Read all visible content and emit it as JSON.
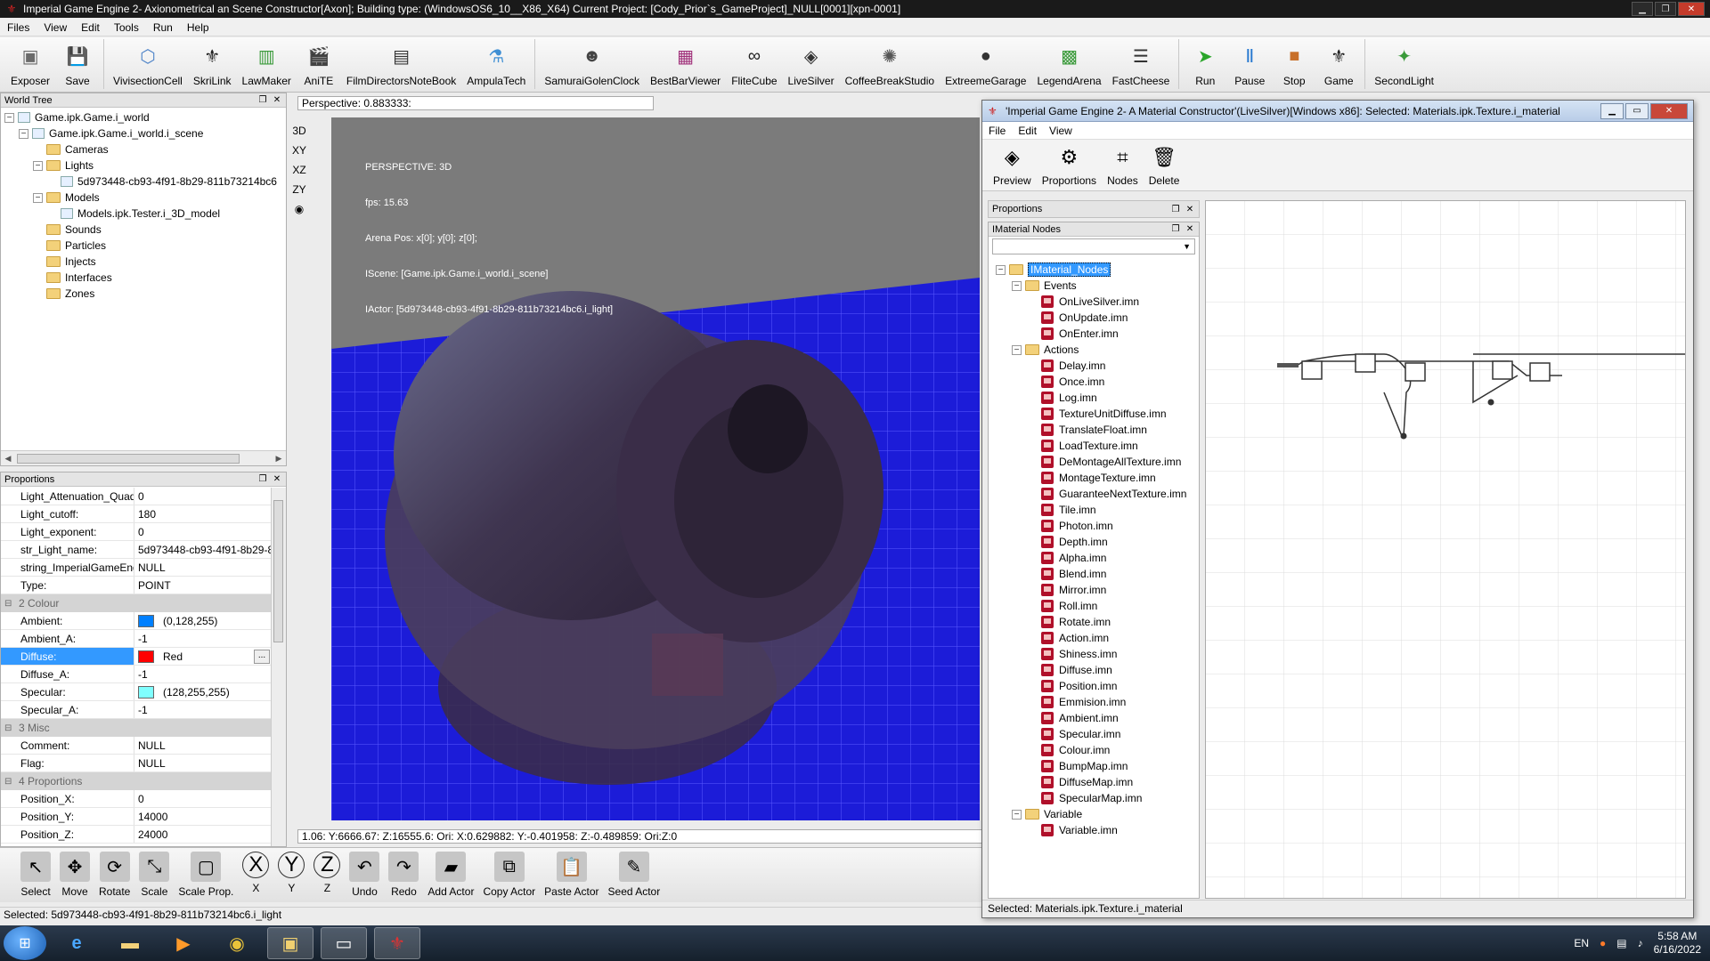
{
  "main_window": {
    "title": "Imperial Game Engine 2- Axionometrical an Scene Constructor[Axon]; Building type: (WindowsOS6_10__X86_X64) Current Project: [Cody_Prior`s_GameProject]_NULL[0001][xpn-0001]"
  },
  "menu": [
    "Files",
    "View",
    "Edit",
    "Tools",
    "Run",
    "Help"
  ],
  "toolbar": [
    {
      "label": "Exposer",
      "icon": "exposer-icon",
      "color": "#6a6a6a"
    },
    {
      "label": "Save",
      "icon": "floppy-icon",
      "color": "#333333"
    },
    {
      "label": "VivisectionCell",
      "icon": "cube-icon",
      "color": "#4f84c8"
    },
    {
      "label": "SkriLink",
      "icon": "eagle-icon",
      "color": "#222222"
    },
    {
      "label": "LawMaker",
      "icon": "chart-icon",
      "color": "#3a9a3a"
    },
    {
      "label": "AniTE",
      "icon": "clapper-icon",
      "color": "#222222"
    },
    {
      "label": "FilmDirectorsNoteBook",
      "icon": "notebook-icon",
      "color": "#333333"
    },
    {
      "label": "AmpulaTech",
      "icon": "ampule-icon",
      "color": "#3f8fd4"
    },
    {
      "label": "SamuraiGolenClock",
      "icon": "mask-icon",
      "color": "#444444"
    },
    {
      "label": "BestBarViewer",
      "icon": "bar-icon",
      "color": "#a0307a"
    },
    {
      "label": "FliteCube",
      "icon": "loop-icon",
      "color": "#222222"
    },
    {
      "label": "LiveSilver",
      "icon": "diamond-icon",
      "color": "#333333"
    },
    {
      "label": "CoffeeBreakStudio",
      "icon": "atom-icon",
      "color": "#555555"
    },
    {
      "label": "ExtreemeGarage",
      "icon": "balls-icon",
      "color": "#333333"
    },
    {
      "label": "LegendArena",
      "icon": "arena-icon",
      "color": "#3a9a3a"
    },
    {
      "label": "FastCheese",
      "icon": "sliders-icon",
      "color": "#333333"
    },
    {
      "label": "Run",
      "icon": "run-icon",
      "color": "#2aa52a"
    },
    {
      "label": "Pause",
      "icon": "pause-icon",
      "color": "#2a7ad0"
    },
    {
      "label": "Stop",
      "icon": "stop-icon",
      "color": "#c8702a"
    },
    {
      "label": "Game",
      "icon": "game-icon",
      "color": "#222222"
    },
    {
      "label": "SecondLight",
      "icon": "secondlight-icon",
      "color": "#3a9a3a"
    }
  ],
  "world_tree": {
    "title": "World Tree",
    "items": [
      {
        "label": "Game.ipk.Game.i_world",
        "level": 0,
        "kind": "node",
        "toggle": "−"
      },
      {
        "label": "Game.ipk.Game.i_world.i_scene",
        "level": 1,
        "kind": "node",
        "toggle": "−"
      },
      {
        "label": "Cameras",
        "level": 2,
        "kind": "folder",
        "toggle": ""
      },
      {
        "label": "Lights",
        "level": 2,
        "kind": "folder",
        "toggle": "−"
      },
      {
        "label": "5d973448-cb93-4f91-8b29-811b73214bc6",
        "level": 3,
        "kind": "node",
        "toggle": ""
      },
      {
        "label": "Models",
        "level": 2,
        "kind": "folder",
        "toggle": "−"
      },
      {
        "label": "Models.ipk.Tester.i_3D_model",
        "level": 3,
        "kind": "node",
        "toggle": ""
      },
      {
        "label": "Sounds",
        "level": 2,
        "kind": "folder",
        "toggle": ""
      },
      {
        "label": "Particles",
        "level": 2,
        "kind": "folder",
        "toggle": ""
      },
      {
        "label": "Injects",
        "level": 2,
        "kind": "folder",
        "toggle": ""
      },
      {
        "label": "Interfaces",
        "level": 2,
        "kind": "folder",
        "toggle": ""
      },
      {
        "label": "Zones",
        "level": 2,
        "kind": "folder",
        "toggle": ""
      }
    ]
  },
  "proportions": {
    "title": "Proportions",
    "rows": [
      {
        "type": "prop",
        "key": "Light_Attenuation_Quad",
        "value": "0"
      },
      {
        "type": "prop",
        "key": "Light_cutoff:",
        "value": "180"
      },
      {
        "type": "prop",
        "key": "Light_exponent:",
        "value": "0"
      },
      {
        "type": "prop",
        "key": "str_Light_name:",
        "value": "5d973448-cb93-4f91-8b29-811b73214bc6"
      },
      {
        "type": "prop",
        "key": "string_ImperialGameEngine",
        "value": "NULL"
      },
      {
        "type": "prop",
        "key": "Type:",
        "value": "POINT"
      },
      {
        "type": "cat",
        "key": "2 Colour"
      },
      {
        "type": "prop",
        "key": "Ambient:",
        "value": "(0,128,255)",
        "swatch": "#0080ff"
      },
      {
        "type": "prop",
        "key": "Ambient_A:",
        "value": "-1"
      },
      {
        "type": "prop",
        "key": "Diffuse:",
        "value": "Red",
        "swatch": "#ff0000",
        "selected": true,
        "button": "..."
      },
      {
        "type": "prop",
        "key": "Diffuse_A:",
        "value": "-1"
      },
      {
        "type": "prop",
        "key": "Specular:",
        "value": "(128,255,255)",
        "swatch": "#80ffff"
      },
      {
        "type": "prop",
        "key": "Specular_A:",
        "value": "-1"
      },
      {
        "type": "cat",
        "key": "3 Misc"
      },
      {
        "type": "prop",
        "key": "Comment:",
        "value": "NULL"
      },
      {
        "type": "prop",
        "key": "Flag:",
        "value": "NULL"
      },
      {
        "type": "cat",
        "key": "4 Proportions"
      },
      {
        "type": "prop",
        "key": "Position_X:",
        "value": "0"
      },
      {
        "type": "prop",
        "key": "Position_Y:",
        "value": "14000"
      },
      {
        "type": "prop",
        "key": "Position_Z:",
        "value": "24000"
      }
    ]
  },
  "view_tools": [
    "3D",
    "XY",
    "XZ",
    "ZY"
  ],
  "viewport": {
    "perspective": "Perspective: 0.883333:",
    "hud": [
      "PERSPECTIVE: 3D",
      "fps: 15.63",
      "Arena Pos: x[0]; y[0]; z[0];",
      "IScene: [Game.ipk.Game.i_world.i_scene]",
      "IActor: [5d973448-cb93-4f91-8b29-811b73214bc6.i_light]"
    ],
    "coords": "1.06: Y:6666.67: Z:16555.6: Ori: X:0.629882: Y:-0.401958: Z:-0.489859: Ori:Z:0"
  },
  "bottom_toolbar": [
    {
      "label": "Select",
      "icon": "select-icon"
    },
    {
      "label": "Move",
      "icon": "move-icon"
    },
    {
      "label": "Rotate",
      "icon": "rotate-icon"
    },
    {
      "label": "Scale",
      "icon": "scale-icon"
    },
    {
      "label": "Scale Prop.",
      "icon": "scale-prop-icon"
    },
    {
      "label": "X",
      "icon": "x-axis-icon",
      "glyph": "X"
    },
    {
      "label": "Y",
      "icon": "y-axis-icon",
      "glyph": "Y"
    },
    {
      "label": "Z",
      "icon": "z-axis-icon",
      "glyph": "Z"
    },
    {
      "label": "Undo",
      "icon": "undo-icon"
    },
    {
      "label": "Redo",
      "icon": "redo-icon"
    },
    {
      "label": "Add Actor",
      "icon": "add-actor-icon"
    },
    {
      "label": "Copy Actor",
      "icon": "copy-actor-icon"
    },
    {
      "label": "Paste Actor",
      "icon": "paste-actor-icon"
    },
    {
      "label": "Seed Actor",
      "icon": "seed-actor-icon"
    }
  ],
  "status": "Selected: 5d973448-cb93-4f91-8b29-811b73214bc6.i_light",
  "material_window": {
    "title": "'Imperial Game Engine 2- A Material Constructor'(LiveSilver)[Windows x86]:   Selected:    Materials.ipk.Texture.i_material",
    "menu": [
      "File",
      "Edit",
      "View"
    ],
    "toolbar": [
      {
        "label": "Preview",
        "icon": "preview-diamond-icon"
      },
      {
        "label": "Proportions",
        "icon": "proportions-gear-icon"
      },
      {
        "label": "Nodes",
        "icon": "nodes-icon"
      },
      {
        "label": "Delete",
        "icon": "trash-icon"
      }
    ],
    "proportions_title": "Proportions",
    "nodes_title": "IMaterial Nodes",
    "tree_root": "IMaterial_Nodes",
    "events_label": "Events",
    "events": [
      "OnLiveSilver.imn",
      "OnUpdate.imn",
      "OnEnter.imn"
    ],
    "actions_label": "Actions",
    "actions": [
      "Delay.imn",
      "Once.imn",
      "Log.imn",
      "TextureUnitDiffuse.imn",
      "TranslateFloat.imn",
      "LoadTexture.imn",
      "DeMontageAllTexture.imn",
      "MontageTexture.imn",
      "GuaranteeNextTexture.imn",
      "Tile.imn",
      "Photon.imn",
      "Depth.imn",
      "Alpha.imn",
      "Blend.imn",
      "Mirror.imn",
      "Roll.imn",
      "Rotate.imn",
      "Action.imn",
      "Shiness.imn",
      "Diffuse.imn",
      "Position.imn",
      "Emmision.imn",
      "Ambient.imn",
      "Specular.imn",
      "Colour.imn",
      "BumpMap.imn",
      "DiffuseMap.imn",
      "SpecularMap.imn"
    ],
    "variable_label": "Variable",
    "variables": [
      "Variable.imn"
    ],
    "status": "Selected:    Materials.ipk.Texture.i_material"
  },
  "taskbar": {
    "lang": "EN",
    "time": "5:58 AM",
    "date": "6/16/2022"
  }
}
